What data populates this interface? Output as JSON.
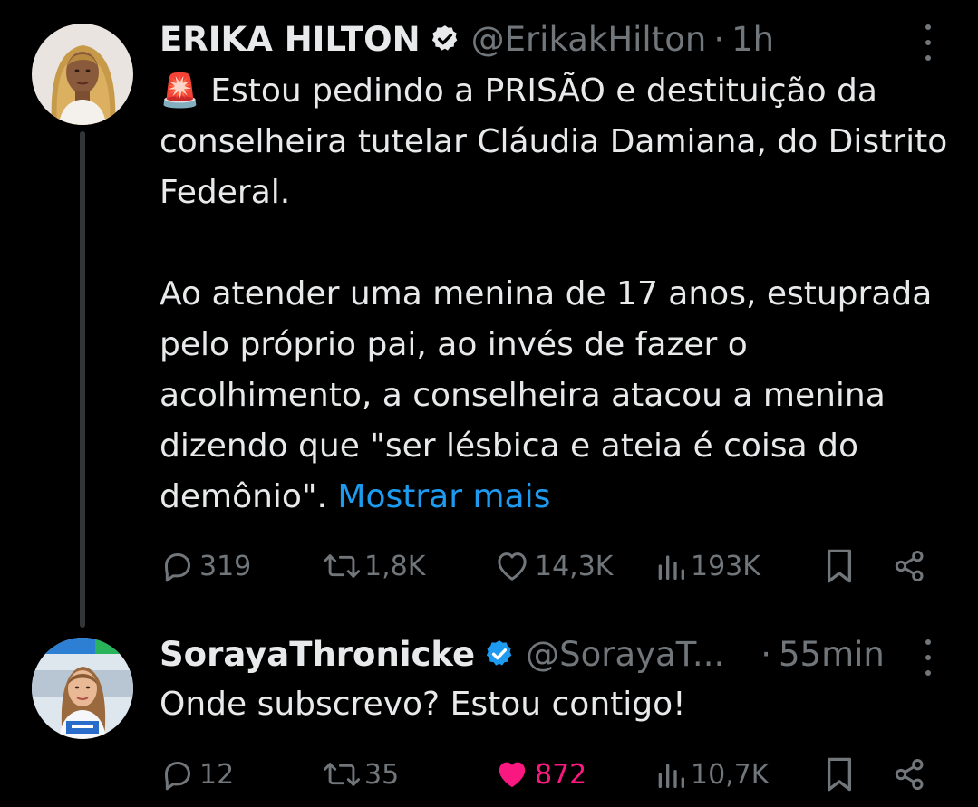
{
  "colors": {
    "background": "#000000",
    "text": "#e7e9ea",
    "muted": "#71767b",
    "link": "#1d9bf0",
    "like_active": "#f91880",
    "verified": "#1d9bf0"
  },
  "tweet1": {
    "name": "ERIKA HILTON",
    "handle": "@ErikakHilton",
    "separator": "·",
    "time": "1h",
    "emoji": "🚨",
    "para1": "Estou pedindo a PRISÃO e destituição da conselheira tutelar Cláudia Damiana, do Distrito Federal.",
    "para2_text": "Ao atender uma menina de 17 anos, estuprada pelo próprio pai, ao invés de fazer o acolhimento, a conselheira atacou a menina dizendo que \"ser lésbica e ateia é coisa do demônio\".",
    "show_more": "Mostrar mais",
    "replies": "319",
    "reposts": "1,8K",
    "likes": "14,3K",
    "views": "193K"
  },
  "tweet2": {
    "name": "SorayaThronicke",
    "handle": "@SorayaT...",
    "separator": "·",
    "time": "55min",
    "text": "Onde subscrevo? Estou contigo!",
    "replies": "12",
    "reposts": "35",
    "likes": "872",
    "views": "10,7K",
    "liked": true
  },
  "icons": {
    "verified": "verified-badge-icon",
    "more": "more-options-icon",
    "reply": "reply-icon",
    "repost": "repost-icon",
    "like": "heart-icon",
    "views": "views-chart-icon",
    "bookmark": "bookmark-icon",
    "share": "share-icon"
  }
}
